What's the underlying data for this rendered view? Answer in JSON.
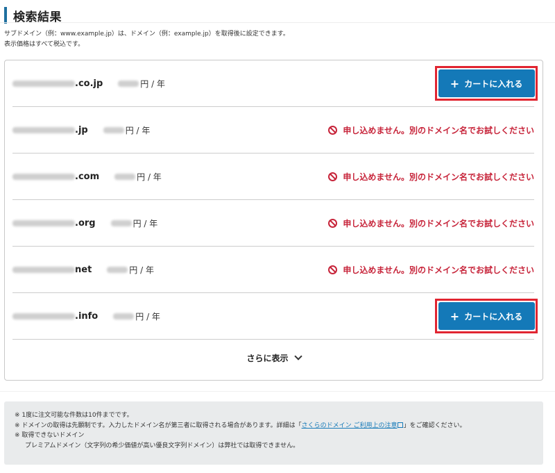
{
  "section": {
    "title": "検索結果",
    "intro_line1": "サブドメイン（例：www.example.jp）は、ドメイン（例：example.jp）を取得後に設定できます。",
    "intro_line2": "表示価格はすべて税込です。"
  },
  "results": [
    {
      "tld": ".co.jp",
      "price_suffix": "円 / 年",
      "available": true,
      "action_label": "カートに入れる"
    },
    {
      "tld": ".jp",
      "price_suffix": "円 / 年",
      "available": false,
      "status_text": "申し込めません。別のドメイン名でお試しください"
    },
    {
      "tld": ".com",
      "price_suffix": "円 / 年",
      "available": false,
      "status_text": "申し込めません。別のドメイン名でお試しください"
    },
    {
      "tld": ".org",
      "price_suffix": "円 / 年",
      "available": false,
      "status_text": "申し込めません。別のドメイン名でお試しください"
    },
    {
      "tld": "net",
      "price_suffix": "円 / 年",
      "available": false,
      "status_text": "申し込めません。別のドメイン名でお試しください"
    },
    {
      "tld": ".info",
      "price_suffix": "円 / 年",
      "available": true,
      "action_label": "カートに入れる"
    }
  ],
  "show_more_label": "さらに表示",
  "notes": {
    "line1": "※ 1度に注文可能な件数は10件までです。",
    "line2_prefix": "※ ドメインの取得は先願制です。入力したドメイン名が第三者に取得される場合があります。詳細は「",
    "line2_link": "さくらのドメイン ご利用上の注意",
    "line2_suffix": "」をご確認ください。",
    "line3": "※ 取得できないドメイン",
    "line4": "プレミアムドメイン（文字列の希少価値が高い優良文字列ドメイン）は弊社では取得できません。"
  },
  "icons": {
    "unavailable": "ban-icon",
    "add": "plus-icon",
    "expand": "chevron-down-icon",
    "external": "external-link-icon"
  },
  "colors": {
    "accent": "#1479b8",
    "error": "#c7243a",
    "highlight_border": "#e12531",
    "heading_bar": "#1e6f9f",
    "notes_bg": "#e9ebec"
  }
}
